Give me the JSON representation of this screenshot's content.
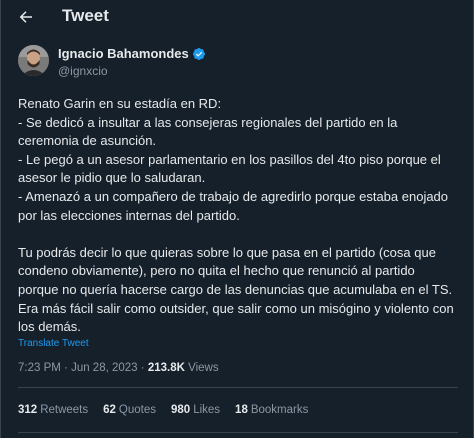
{
  "header": {
    "title": "Tweet"
  },
  "author": {
    "name": "Ignacio Bahamondes",
    "handle": "@ignxcio"
  },
  "tweet": {
    "paragraph1": "Renato Garin en su estadía en RD:\n- Se dedicó a insultar a las consejeras regionales del partido en la ceremonia de asunción.\n- Le pegó a un asesor parlamentario en los pasillos del 4to piso porque el asesor le pidio que lo saludaran.\n- Amenazó a un compañero de trabajo de agredirlo porque estaba enojado por las elecciones internas del partido.",
    "paragraph2": "Tu podrás decir lo que quieras sobre lo que pasa en el partido (cosa que condeno obviamente), pero no quita el hecho que renunció al partido porque no quería hacerse cargo de las denuncias que acumulaba en el TS. Era más fácil salir como outsider, que salir como un misógino y violento con los demás.",
    "translate_label": "Translate Tweet"
  },
  "meta": {
    "time": "7:23 PM",
    "separator": " · ",
    "date": "Jun 28, 2023",
    "views_count": "213.8K",
    "views_label": " Views"
  },
  "stats": {
    "retweets_count": "312",
    "retweets_label": "Retweets",
    "quotes_count": "62",
    "quotes_label": "Quotes",
    "likes_count": "980",
    "likes_label": "Likes",
    "bookmarks_count": "18",
    "bookmarks_label": "Bookmarks"
  },
  "colors": {
    "background": "#15202b",
    "text": "#e7e9ea",
    "muted": "#8b98a5",
    "accent": "#1d9bf0",
    "border": "#38444d"
  },
  "icons": {
    "back": "arrow-left-icon",
    "verified": "verified-badge-icon"
  }
}
